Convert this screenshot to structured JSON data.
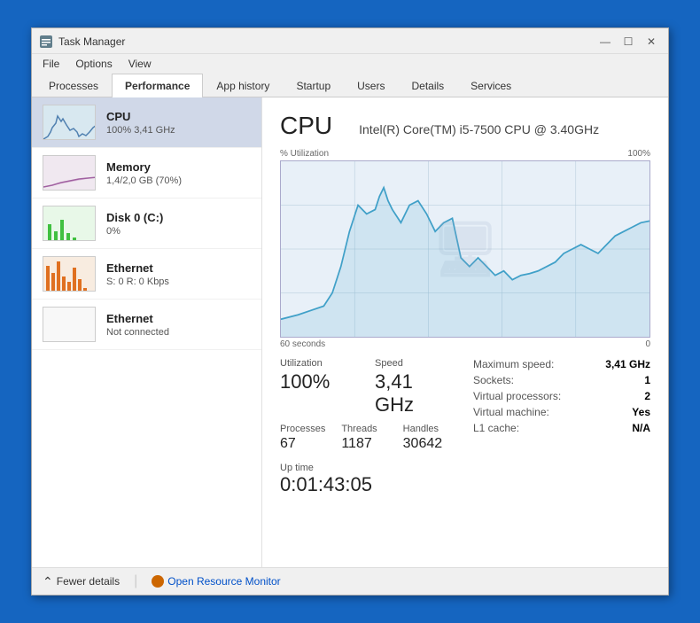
{
  "window": {
    "title": "Task Manager",
    "controls": {
      "minimize": "—",
      "maximize": "☐",
      "close": "✕"
    }
  },
  "menu": {
    "items": [
      "File",
      "Options",
      "View"
    ]
  },
  "tabs": [
    {
      "label": "Processes",
      "active": false
    },
    {
      "label": "Performance",
      "active": true
    },
    {
      "label": "App history",
      "active": false
    },
    {
      "label": "Startup",
      "active": false
    },
    {
      "label": "Users",
      "active": false
    },
    {
      "label": "Details",
      "active": false
    },
    {
      "label": "Services",
      "active": false
    }
  ],
  "sidebar": {
    "items": [
      {
        "id": "cpu",
        "title": "CPU",
        "sub": "100% 3,41 GHz",
        "active": true,
        "color": "#5080b0"
      },
      {
        "id": "memory",
        "title": "Memory",
        "sub": "1,4/2,0 GB (70%)",
        "active": false,
        "color": "#a060a0"
      },
      {
        "id": "disk",
        "title": "Disk 0 (C:)",
        "sub": "0%",
        "active": false,
        "color": "#50b050"
      },
      {
        "id": "ethernet1",
        "title": "Ethernet",
        "sub": "S: 0  R: 0 Kbps",
        "active": false,
        "color": "#c07030"
      },
      {
        "id": "ethernet2",
        "title": "Ethernet",
        "sub": "Not connected",
        "active": false,
        "color": "#aaaaaa"
      }
    ]
  },
  "main": {
    "cpu_title": "CPU",
    "cpu_model": "Intel(R) Core(TM) i5-7500 CPU @ 3.40GHz",
    "graph": {
      "y_label": "% Utilization",
      "y_max": "100%",
      "x_start": "60 seconds",
      "x_end": "0"
    },
    "stats": {
      "utilization_label": "Utilization",
      "utilization_value": "100%",
      "speed_label": "Speed",
      "speed_value": "3,41 GHz",
      "processes_label": "Processes",
      "processes_value": "67",
      "threads_label": "Threads",
      "threads_value": "1187",
      "handles_label": "Handles",
      "handles_value": "30642",
      "uptime_label": "Up time",
      "uptime_value": "0:01:43:05"
    },
    "right_stats": {
      "max_speed_label": "Maximum speed:",
      "max_speed_val": "3,41 GHz",
      "sockets_label": "Sockets:",
      "sockets_val": "1",
      "vproc_label": "Virtual processors:",
      "vproc_val": "2",
      "vm_label": "Virtual machine:",
      "vm_val": "Yes",
      "l1_label": "L1 cache:",
      "l1_val": "N/A"
    }
  },
  "footer": {
    "fewer_details": "Fewer details",
    "open_monitor": "Open Resource Monitor"
  }
}
